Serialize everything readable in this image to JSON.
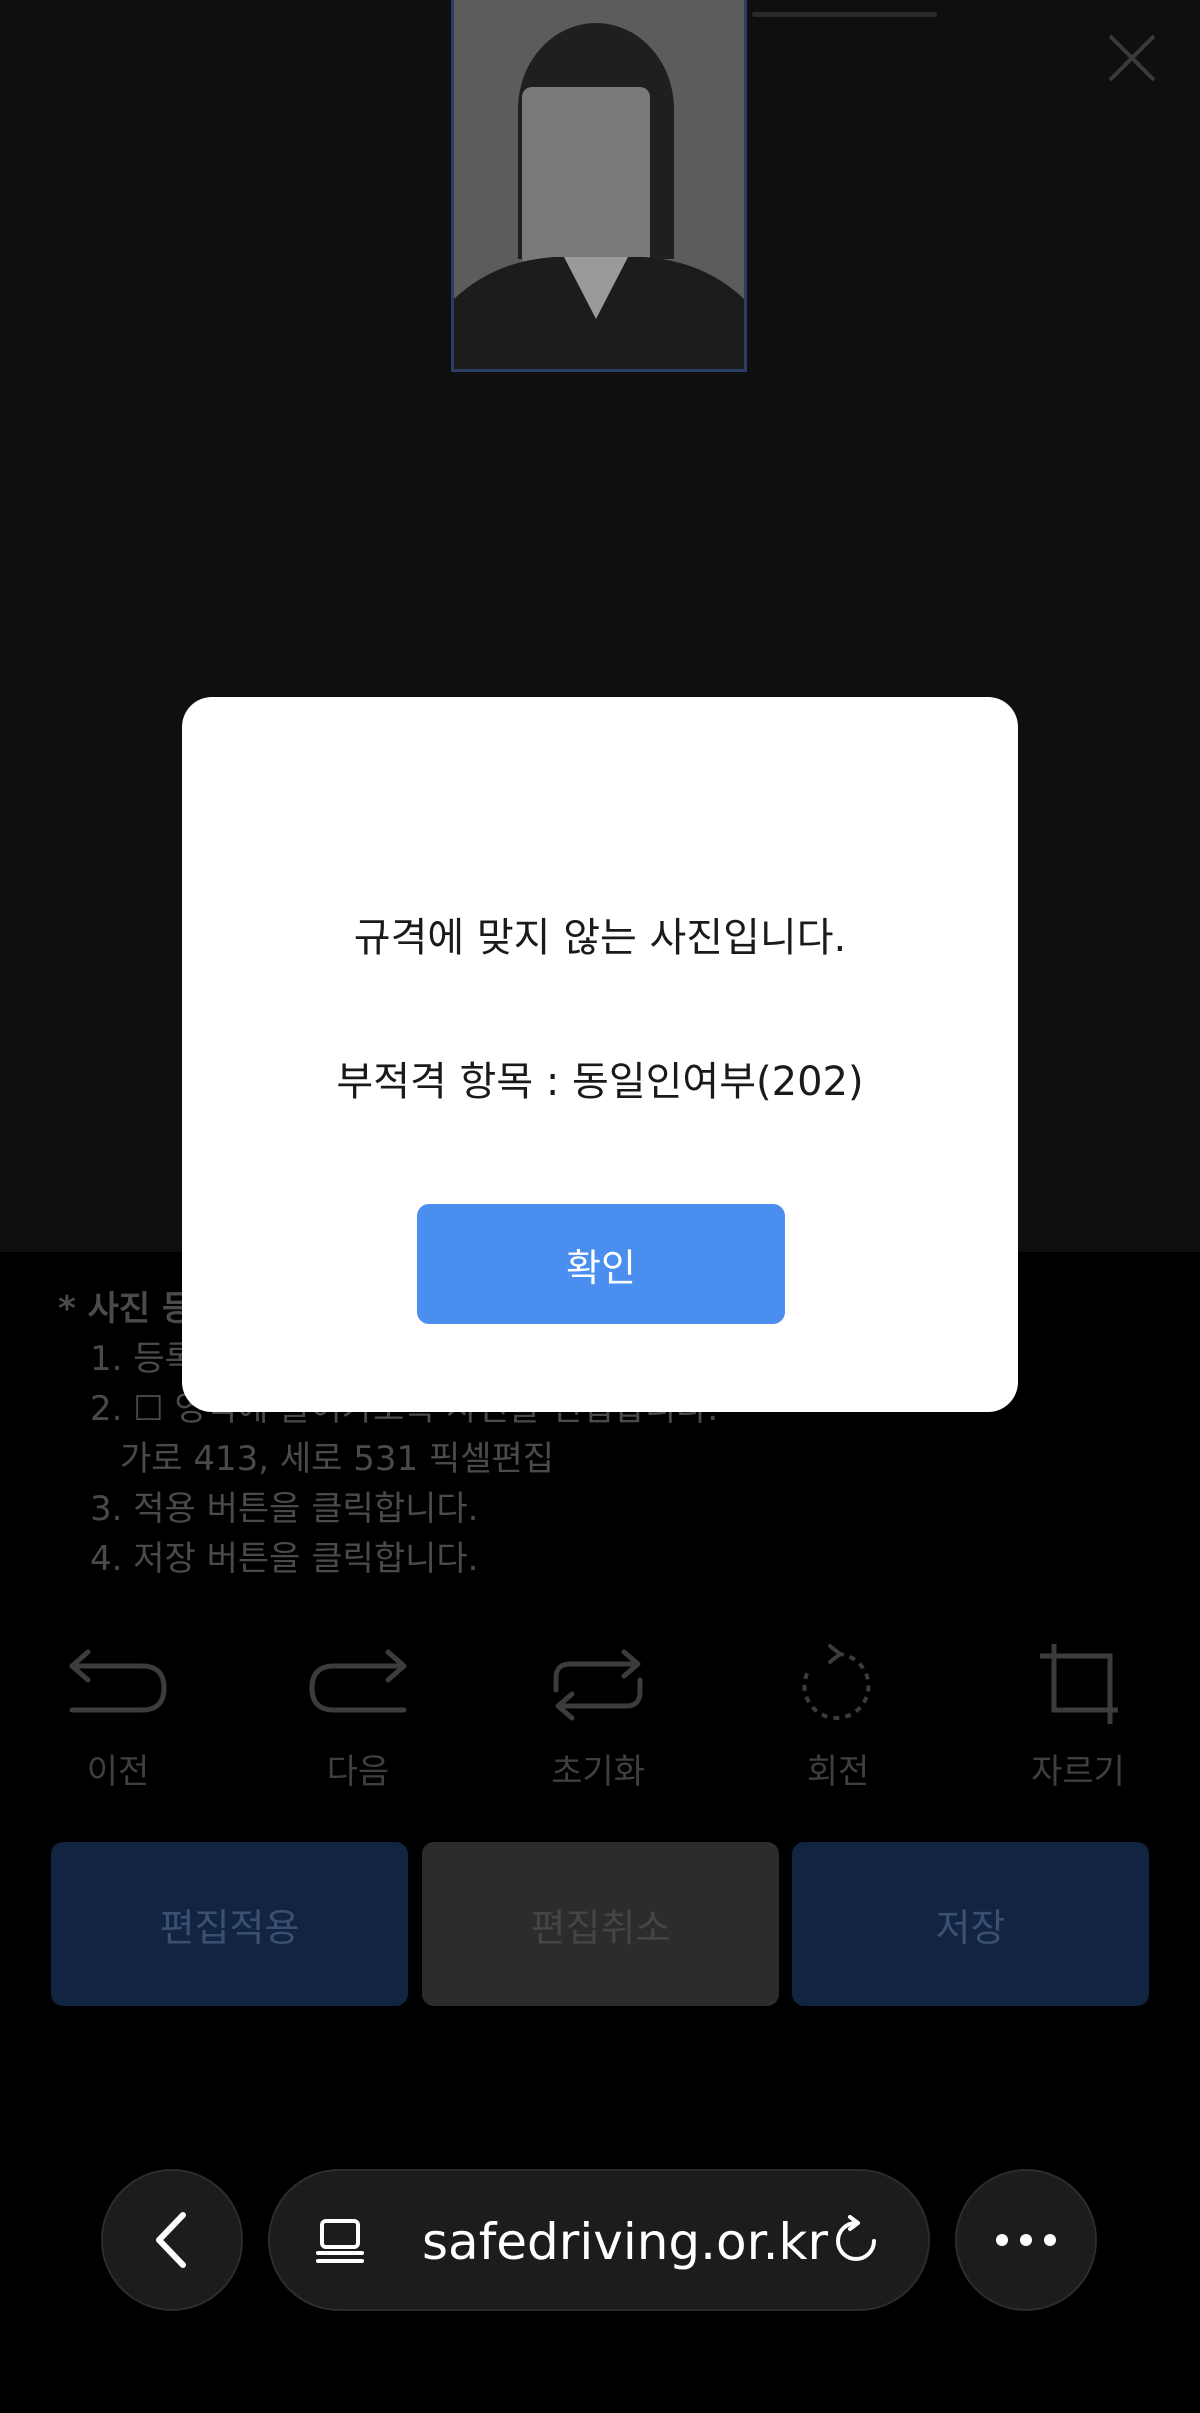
{
  "instructions": {
    "heading": "* 사진 등",
    "step1": "1. 등록",
    "step2": "2. ☐ 영역에 들어가도록 사진을 편집합니다.",
    "step2_sub": "가로 413, 세로 531 픽셀편집",
    "step3": "3. 적용 버튼을 클릭합니다.",
    "step4": "4. 저장 버튼을 클릭합니다."
  },
  "toolbar": {
    "undo": {
      "label": "이전",
      "icon": "undo-arrow-icon"
    },
    "redo": {
      "label": "다음",
      "icon": "redo-arrow-icon"
    },
    "reset": {
      "label": "초기화",
      "icon": "reset-loop-icon"
    },
    "rotate": {
      "label": "회전",
      "icon": "rotate-icon"
    },
    "crop": {
      "label": "자르기",
      "icon": "crop-icon"
    }
  },
  "actions": {
    "apply": "편집적용",
    "cancel": "편집취소",
    "save": "저장"
  },
  "modal": {
    "message": "규격에 맞지 않는 사진입니다.",
    "detail": "부적격 항목 : 동일인여부(202)",
    "ok_label": "확인"
  },
  "browser": {
    "url": "safedriving.or.kr",
    "icons": [
      "back-chevron-icon",
      "tabs-icon",
      "reload-icon",
      "more-dots-icon"
    ]
  },
  "colors": {
    "primary": "#4a8ef0",
    "dimmed_primary": "#112441",
    "modal_bg": "#ffffff"
  }
}
